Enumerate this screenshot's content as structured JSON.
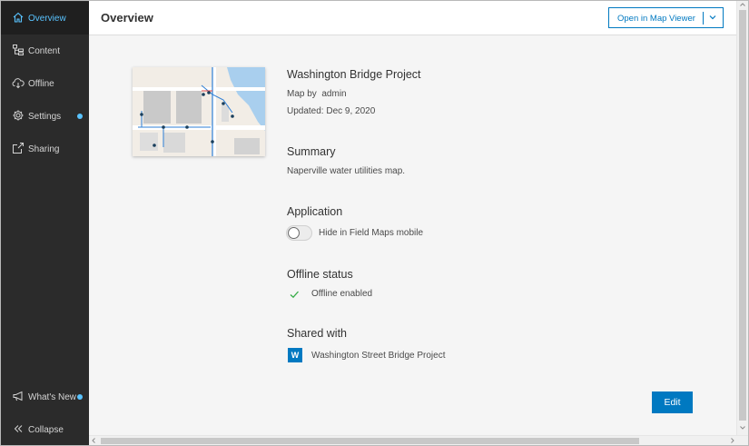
{
  "sidebar": {
    "items": [
      {
        "label": "Overview",
        "icon": "home-icon",
        "active": true
      },
      {
        "label": "Content",
        "icon": "layers-tree-icon"
      },
      {
        "label": "Offline",
        "icon": "cloud-download-icon"
      },
      {
        "label": "Settings",
        "icon": "gear-icon",
        "indicator": true
      },
      {
        "label": "Sharing",
        "icon": "share-icon"
      }
    ],
    "whats_new": {
      "label": "What's New",
      "icon": "megaphone-icon",
      "indicator": true
    },
    "collapse": {
      "label": "Collapse",
      "icon": "chevrons-left-icon"
    }
  },
  "header": {
    "title": "Overview",
    "open_button": "Open in Map Viewer"
  },
  "map": {
    "title": "Washington Bridge Project",
    "owner_label": "Map by",
    "owner": "admin",
    "updated": "Updated: Dec 9, 2020"
  },
  "summary": {
    "heading": "Summary",
    "text": "Naperville water utilities map."
  },
  "application": {
    "heading": "Application",
    "toggle_label": "Hide in Field Maps mobile",
    "toggle_on": false
  },
  "offline": {
    "heading": "Offline status",
    "status": "Offline enabled"
  },
  "shared": {
    "heading": "Shared with",
    "group_initial": "W",
    "group_name": "Washington Street Bridge Project"
  },
  "actions": {
    "edit": "Edit"
  },
  "colors": {
    "accent": "#0079c1",
    "sidebar_bg": "#2b2b2b",
    "active_text": "#59c3ff",
    "check": "#35ac46"
  }
}
